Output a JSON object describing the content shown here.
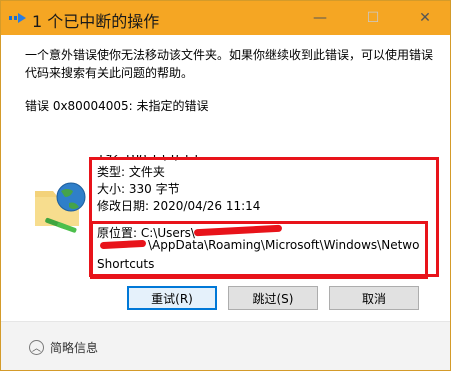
{
  "window": {
    "title": "1 个已中断的操作",
    "minimize_glyph": "—",
    "maximize_glyph": "☐",
    "close_glyph": "✕"
  },
  "message": "一个意外错误使你无法移动该文件夹。如果你继续收到此错误，可以使用错误代码来搜索有关此问题的帮助。",
  "error": "错误 0x80004005: 未指定的错误",
  "file_info": {
    "partial_line": "192.168.1 (5).15",
    "type": "类型: 文件夹",
    "size": "大小: 330 字节",
    "modified": "修改日期: 2020/04/26 11:14",
    "location_line1": "原位置: C:\\Users\\",
    "location_line2": "\\AppData\\Roaming\\Microsoft\\Windows\\Netwo",
    "location_line3": "Shortcuts"
  },
  "buttons": {
    "retry": "重试(R)",
    "skip": "跳过(S)",
    "cancel": "取消"
  },
  "footer": {
    "details_label": "简略信息",
    "chevron_glyph": "︿"
  },
  "colors": {
    "titlebar": "#f5a623",
    "annotation_red": "#e8131a",
    "default_button_border": "#0078d7"
  }
}
